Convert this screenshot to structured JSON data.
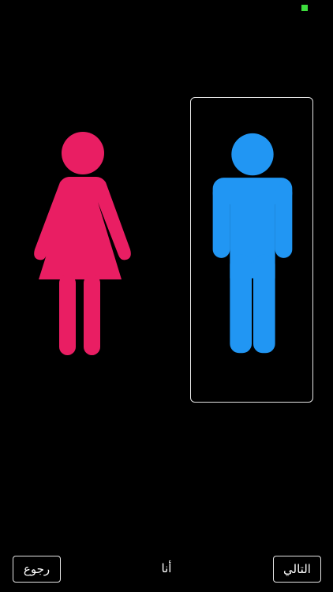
{
  "colors": {
    "background": "#000000",
    "female_figure": "#E91E63",
    "male_figure": "#2196F3",
    "selection_border": "#E6E6E6",
    "status_indicator": "#3DDC3D",
    "text": "#FFFFFF"
  },
  "options": {
    "female": {
      "icon": "female-figure-icon",
      "selected": false
    },
    "male": {
      "icon": "male-figure-icon",
      "selected": true
    }
  },
  "footer": {
    "back_label": "رجوع",
    "center_label": "أنا",
    "next_label": "التالي"
  }
}
